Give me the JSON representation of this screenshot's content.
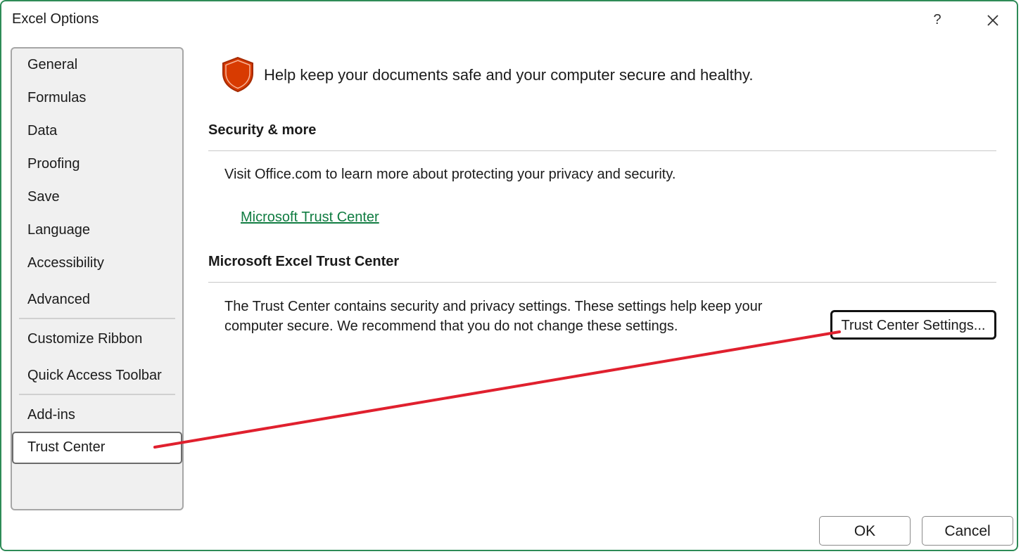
{
  "window": {
    "title": "Excel Options",
    "help_label": "?"
  },
  "sidebar": {
    "items": [
      {
        "label": "General"
      },
      {
        "label": "Formulas"
      },
      {
        "label": "Data"
      },
      {
        "label": "Proofing"
      },
      {
        "label": "Save"
      },
      {
        "label": "Language"
      },
      {
        "label": "Accessibility"
      },
      {
        "label": "Advanced"
      },
      {
        "label": "Customize Ribbon"
      },
      {
        "label": "Quick Access Toolbar"
      },
      {
        "label": "Add-ins"
      },
      {
        "label": "Trust Center"
      }
    ],
    "selected": "Trust Center"
  },
  "main": {
    "headline": "Help keep your documents safe and your computer secure and healthy.",
    "security_section": {
      "title": "Security & more",
      "text": "Visit Office.com to learn more about protecting your privacy and security.",
      "link_label": "Microsoft Trust Center"
    },
    "trust_section": {
      "title": "Microsoft Excel Trust Center",
      "text_line1": "The Trust Center contains security and privacy settings. These settings help keep your",
      "text_line2": "computer secure. We recommend that you do not change these settings.",
      "button_label": "Trust Center Settings..."
    }
  },
  "footer": {
    "ok_label": "OK",
    "cancel_label": "Cancel"
  },
  "colors": {
    "accent": "#107c41",
    "window_border": "#2e8b57",
    "shield_fill": "#d83b01",
    "annotation_line": "#e0202e"
  },
  "icons": {
    "shield": "shield-icon",
    "close": "close-icon"
  }
}
